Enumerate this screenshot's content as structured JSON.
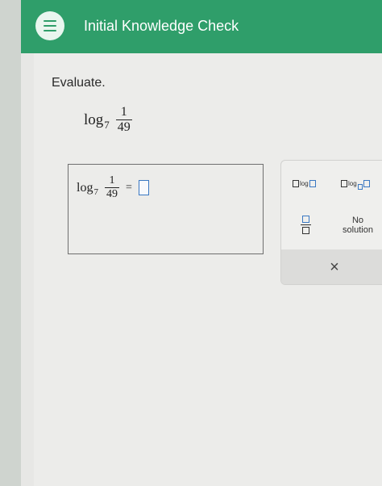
{
  "header": {
    "title": "Initial Knowledge Check",
    "menu_icon": "hamburger-menu-icon",
    "accent": "#2f9e6a"
  },
  "question": {
    "prompt": "Evaluate.",
    "log_text": "log",
    "base": "7",
    "numerator": "1",
    "denominator": "49"
  },
  "answer": {
    "log_text": "log",
    "base": "7",
    "numerator": "1",
    "denominator": "49",
    "equals": "="
  },
  "palette": {
    "log_label": "log",
    "log_base_label": "log",
    "no_solution_line1": "No",
    "no_solution_line2": "solution",
    "clear_symbol": "×"
  }
}
